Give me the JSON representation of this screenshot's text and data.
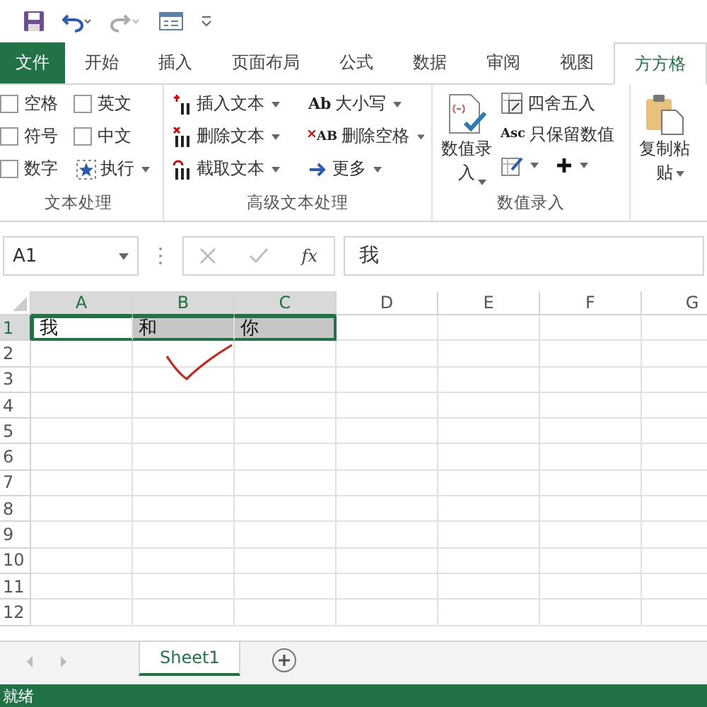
{
  "tabs": [
    {
      "label": "文件",
      "kind": "file",
      "selected": false
    },
    {
      "label": "开始",
      "kind": "tab",
      "selected": false
    },
    {
      "label": "插入",
      "kind": "tab",
      "selected": false
    },
    {
      "label": "页面布局",
      "kind": "tab",
      "selected": false
    },
    {
      "label": "公式",
      "kind": "tab",
      "selected": false
    },
    {
      "label": "数据",
      "kind": "tab",
      "selected": false
    },
    {
      "label": "审阅",
      "kind": "tab",
      "selected": false
    },
    {
      "label": "视图",
      "kind": "tab",
      "selected": false
    },
    {
      "label": "方方格",
      "kind": "tab",
      "selected": true
    }
  ],
  "ribbon": {
    "text_group": {
      "label": "文本处理",
      "checkboxes": [
        {
          "label": "空格",
          "checked": false
        },
        {
          "label": "英文",
          "checked": false
        },
        {
          "label": "符号",
          "checked": false
        },
        {
          "label": "中文",
          "checked": false
        },
        {
          "label": "数字",
          "checked": false
        }
      ],
      "run_button": "执行"
    },
    "advanced_group": {
      "label": "高级文本处理",
      "buttons": [
        {
          "label": "插入文本",
          "kind": "insert"
        },
        {
          "label": "删除文本",
          "kind": "delete"
        },
        {
          "label": "截取文本",
          "kind": "extract"
        },
        {
          "label": "大小写",
          "kind": "case",
          "icon_text": "Ab"
        },
        {
          "label": "删除空格",
          "kind": "space",
          "icon_text": "AB"
        },
        {
          "label": "更多",
          "kind": "more"
        }
      ]
    },
    "number_group": {
      "label": "数值录入",
      "large_button": [
        "数值录",
        "入"
      ],
      "round_button": "四舍五入",
      "keep_button": "只保留数值",
      "keep_icon_text": "Asc"
    },
    "copy_group": {
      "large_button": [
        "复制粘",
        "贴"
      ]
    }
  },
  "formula_bar": {
    "name_box": "A1",
    "fx": "fx",
    "value": "我"
  },
  "grid": {
    "columns": [
      {
        "label": "A",
        "selected": true
      },
      {
        "label": "B",
        "selected": true
      },
      {
        "label": "C",
        "selected": true
      },
      {
        "label": "D",
        "selected": false
      },
      {
        "label": "E",
        "selected": false
      },
      {
        "label": "F",
        "selected": false
      },
      {
        "label": "G",
        "selected": false
      }
    ],
    "rows": [
      {
        "label": "1",
        "selected": true,
        "cells": [
          {
            "value": "我",
            "selected": true,
            "active": true
          },
          {
            "value": "和",
            "selected": true,
            "active": false
          },
          {
            "value": "你",
            "selected": true,
            "active": false
          }
        ]
      },
      {
        "label": "2",
        "selected": false
      },
      {
        "label": "3",
        "selected": false
      },
      {
        "label": "4",
        "selected": false
      },
      {
        "label": "5",
        "selected": false
      },
      {
        "label": "6",
        "selected": false
      },
      {
        "label": "7",
        "selected": false
      },
      {
        "label": "8",
        "selected": false
      },
      {
        "label": "9",
        "selected": false
      },
      {
        "label": "10",
        "selected": false
      },
      {
        "label": "11",
        "selected": false
      },
      {
        "label": "12",
        "selected": false
      }
    ]
  },
  "sheets": [
    {
      "label": "Sheet1",
      "selected": true
    }
  ],
  "status_bar": "就绪"
}
